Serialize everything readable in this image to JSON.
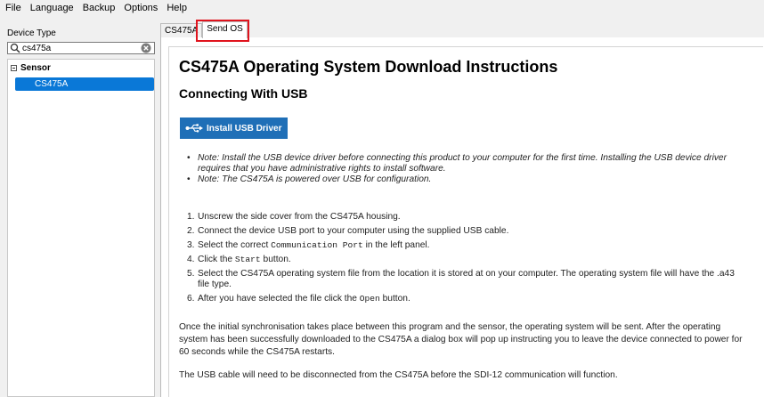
{
  "menu": [
    "File",
    "Language",
    "Backup",
    "Options",
    "Help"
  ],
  "left_panel": {
    "label": "Device Type",
    "search_value": "cs475a",
    "group": "Sensor",
    "item": "CS475A"
  },
  "tabs": [
    "CS475A",
    "Send OS"
  ],
  "doc": {
    "title": "CS475A Operating System Download Instructions",
    "subtitle": "Connecting With USB",
    "button": "Install USB Driver",
    "notes": [
      "Note: Install the USB device driver before connecting this product to your computer for the first time. Installing the USB device driver requires that you have administrative rights to install software.",
      "Note: The CS475A is powered over USB for configuration."
    ],
    "steps": {
      "s1_num": "1.",
      "s1": "Unscrew the side cover from the CS475A housing.",
      "s2_num": "2.",
      "s2": "Connect the device USB port to your computer using the supplied USB cable.",
      "s3_num": "3.",
      "s3_a": "Select the correct ",
      "s3_code": "Communication Port",
      "s3_b": " in the left panel.",
      "s4_num": "4.",
      "s4_a": "Click the ",
      "s4_code": "Start",
      "s4_b": " button.",
      "s5_num": "5.",
      "s5": "Select the CS475A operating system file from the location it is stored at on your computer. The operating system file will have the .a43 file type.",
      "s6_num": "6.",
      "s6_a": "After you have selected the file click the ",
      "s6_code": "Open",
      "s6_b": " button."
    },
    "para1": "Once the initial synchronisation takes place between this program and the sensor, the operating system will be sent. After the operating system has been successfully downloaded to the CS475A a dialog box will pop up instructing you to leave the device connected to power for 60 seconds while the CS475A restarts.",
    "para2": "The USB cable will need to be disconnected from the CS475A before the SDI-12 communication will function."
  },
  "colors": {
    "accent": "#0a78d7",
    "button": "#1f6fb7",
    "highlight": "#e0141e"
  },
  "icons": [
    "search-icon",
    "clear-icon",
    "collapse-icon",
    "usb-icon"
  ]
}
